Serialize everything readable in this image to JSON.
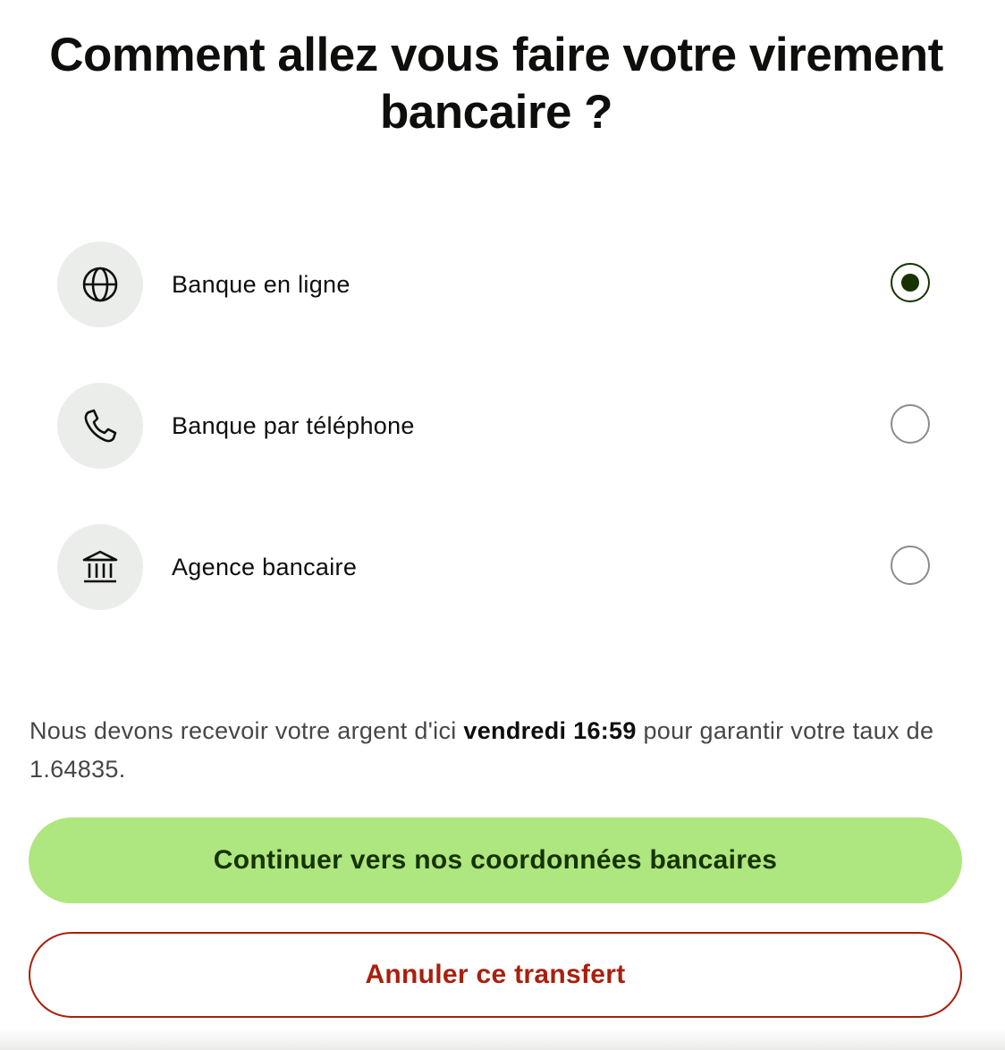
{
  "heading": "Comment allez vous faire votre virement bancaire ?",
  "options": [
    {
      "label": "Banque en ligne",
      "icon": "globe-icon",
      "selected": true
    },
    {
      "label": "Banque par téléphone",
      "icon": "phone-icon",
      "selected": false
    },
    {
      "label": "Agence bancaire",
      "icon": "bank-building-icon",
      "selected": false
    }
  ],
  "notice": {
    "before": "Nous devons recevoir votre argent d'ici ",
    "deadline": "vendredi 16:59",
    "after": " pour garantir votre taux de 1.64835."
  },
  "buttons": {
    "continue_label": "Continuer vers nos coordonnées bancaires",
    "cancel_label": "Annuler ce transfert"
  },
  "colors": {
    "primary_button_bg": "#aee67f",
    "primary_button_text": "#163300",
    "cancel_accent": "#a8200d",
    "icon_circle_bg": "#ebedea",
    "radio_selected": "#163300"
  }
}
